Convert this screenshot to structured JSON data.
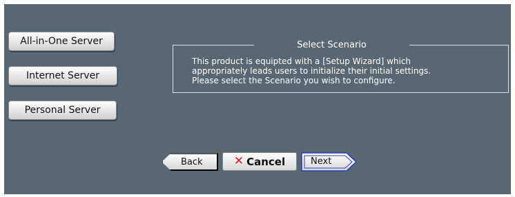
{
  "scenarios": {
    "all_in_one": "All-in-One Server",
    "internet": "Internet Server",
    "personal": "Personal Server"
  },
  "select_scenario": {
    "legend": "Select Scenario",
    "lines": [
      "This product is equipted with a [Setup Wizard] which",
      "appropriately leads users to initialize their initial settings.",
      "Please select the Scenario you wish to configure."
    ]
  },
  "nav": {
    "back": "Back",
    "cancel": "Cancel",
    "next": "Next"
  },
  "icons": {
    "cancel": "x-icon",
    "back": "left-arrow-icon",
    "next": "right-arrow-icon"
  },
  "colors": {
    "panel_bg": "#596772",
    "cancel_x": "#e11b1b",
    "next_border": "#2b3fbd"
  }
}
